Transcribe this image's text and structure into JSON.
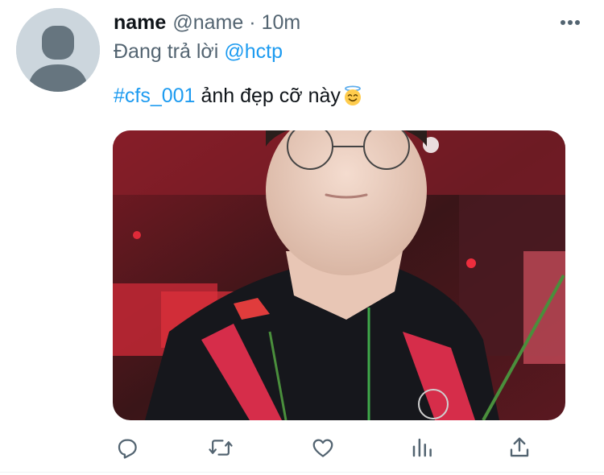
{
  "tweet": {
    "display_name": "name",
    "handle": "@name",
    "separator": "·",
    "time": "10m",
    "replying_prefix": "Đang trả lời",
    "replying_to": "@hctp",
    "hashtag": "#cfs_001",
    "text": "ảnh đẹp cỡ này",
    "emoji": "smiling-face-with-halo-icon",
    "avatar": "default-avatar-icon",
    "media_description": "photo"
  },
  "actions": [
    {
      "name": "reply",
      "icon": "reply-icon"
    },
    {
      "name": "retweet",
      "icon": "retweet-icon"
    },
    {
      "name": "like",
      "icon": "heart-icon"
    },
    {
      "name": "analytics",
      "icon": "analytics-icon"
    },
    {
      "name": "share",
      "icon": "share-icon"
    }
  ],
  "colors": {
    "accent": "#1d9bf0",
    "secondary_text": "#536471",
    "primary_text": "#0f1419",
    "avatar_bg": "#ccd6dd"
  }
}
